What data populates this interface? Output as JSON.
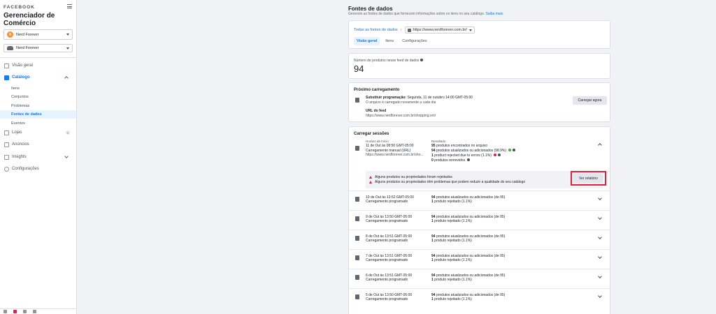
{
  "sidebar": {
    "brand": "FACEBOOK",
    "app_title": "Gerenciador de Comércio",
    "account": {
      "initial": "N",
      "name": "Nerd Forever"
    },
    "catalog": {
      "name": "Nerd Forever"
    },
    "nav": {
      "overview": "Visão geral",
      "catalog": "Catálogo",
      "catalog_sub": [
        "Itens",
        "Conjuntos",
        "Problemas",
        "Fontes de dados",
        "Eventos"
      ],
      "stores": "Lojas",
      "stores_count": "1",
      "ads": "Anúncios",
      "insights": "Insights",
      "settings": "Configurações"
    }
  },
  "header": {
    "title": "Fontes de dados",
    "subtitle": "Gerencie as fontes de dados que fornecem informações sobre os itens no seu catálogo.",
    "learn_more": "Saiba mais"
  },
  "source_card": {
    "breadcrumb_root": "Todas as fontes de dados",
    "feed_url": "https://www.nerdforever.com.br/",
    "tabs": [
      "Visão geral",
      "Itens",
      "Configurações"
    ]
  },
  "products_card": {
    "label": "Número de produtos nesse feed de dados",
    "value": "94"
  },
  "next_upload": {
    "title": "Próximo carregamento",
    "schedule_bold": "Substituir programação:",
    "schedule_text": "Segunda, 11 de outubro 14:00 GMT-05:00",
    "note": "O arquivo é carregado novamente a cada dia",
    "feed_url_label": "URL do feed",
    "feed_url": "https://www.nerdforever.com.br/shopping.xml",
    "button": "Carregar agora"
  },
  "sessions": {
    "title": "Carregar sessões",
    "expanded": {
      "start_label": "Horário de início",
      "start_time": "11 de Out às 08:50 GMT-05:00",
      "type": "Carregamento manual (URL)",
      "url": "https://www.nerdforever.com.br/sho...",
      "result_label": "Resultado",
      "results": [
        {
          "num": "95",
          "text": "produtos encontrados no arquivo"
        },
        {
          "num": "94",
          "text": "produtos atualizados ou adicionados (98.9%)"
        },
        {
          "num": "1",
          "text": "product rejected due to errors (1.1%)"
        },
        {
          "num": "0",
          "text": "produtos removidos"
        }
      ],
      "warnings": [
        "Alguns produtos ou propriedades foram rejeitados",
        "Alguns produtos ou propriedades têm problemas que podem reduzir a qualidade do seu catálogo"
      ],
      "report_button": "Ver relatório"
    },
    "rows": [
      {
        "time": "10 de Out às 13:52 GMT-05:00",
        "type": "Carregamento programado",
        "updated": "94",
        "updated_text": "produtos atualizados ou adicionados (de 95)",
        "rejected": "1",
        "rejected_text": "produto rejeitado (1.1%)"
      },
      {
        "time": "9 de Out às 13:50 GMT-05:00",
        "type": "Carregamento programado",
        "updated": "94",
        "updated_text": "produtos atualizados ou adicionados (de 95)",
        "rejected": "1",
        "rejected_text": "produto rejeitado (1.1%)"
      },
      {
        "time": "8 de Out às 13:51 GMT-05:00",
        "type": "Carregamento programado",
        "updated": "94",
        "updated_text": "produtos atualizados ou adicionados (de 95)",
        "rejected": "1",
        "rejected_text": "produto rejeitado (1.1%)"
      },
      {
        "time": "7 de Out às 13:51 GMT-05:00",
        "type": "Carregamento programado",
        "updated": "94",
        "updated_text": "produtos atualizados ou adicionados (de 95)",
        "rejected": "1",
        "rejected_text": "produto rejeitado (1.1%)"
      },
      {
        "time": "6 de Out às 13:51 GMT-05:00",
        "type": "Carregamento programado",
        "updated": "94",
        "updated_text": "produtos atualizados ou adicionados (de 95)",
        "rejected": "1",
        "rejected_text": "produto rejeitado (1.1%)"
      },
      {
        "time": "5 de Out às 13:50 GMT-05:00",
        "type": "Carregamento programado",
        "updated": "94",
        "updated_text": "produtos atualizados ou adicionados (de 95)",
        "rejected": "1",
        "rejected_text": "produto rejeitado (1.1%)"
      }
    ]
  }
}
